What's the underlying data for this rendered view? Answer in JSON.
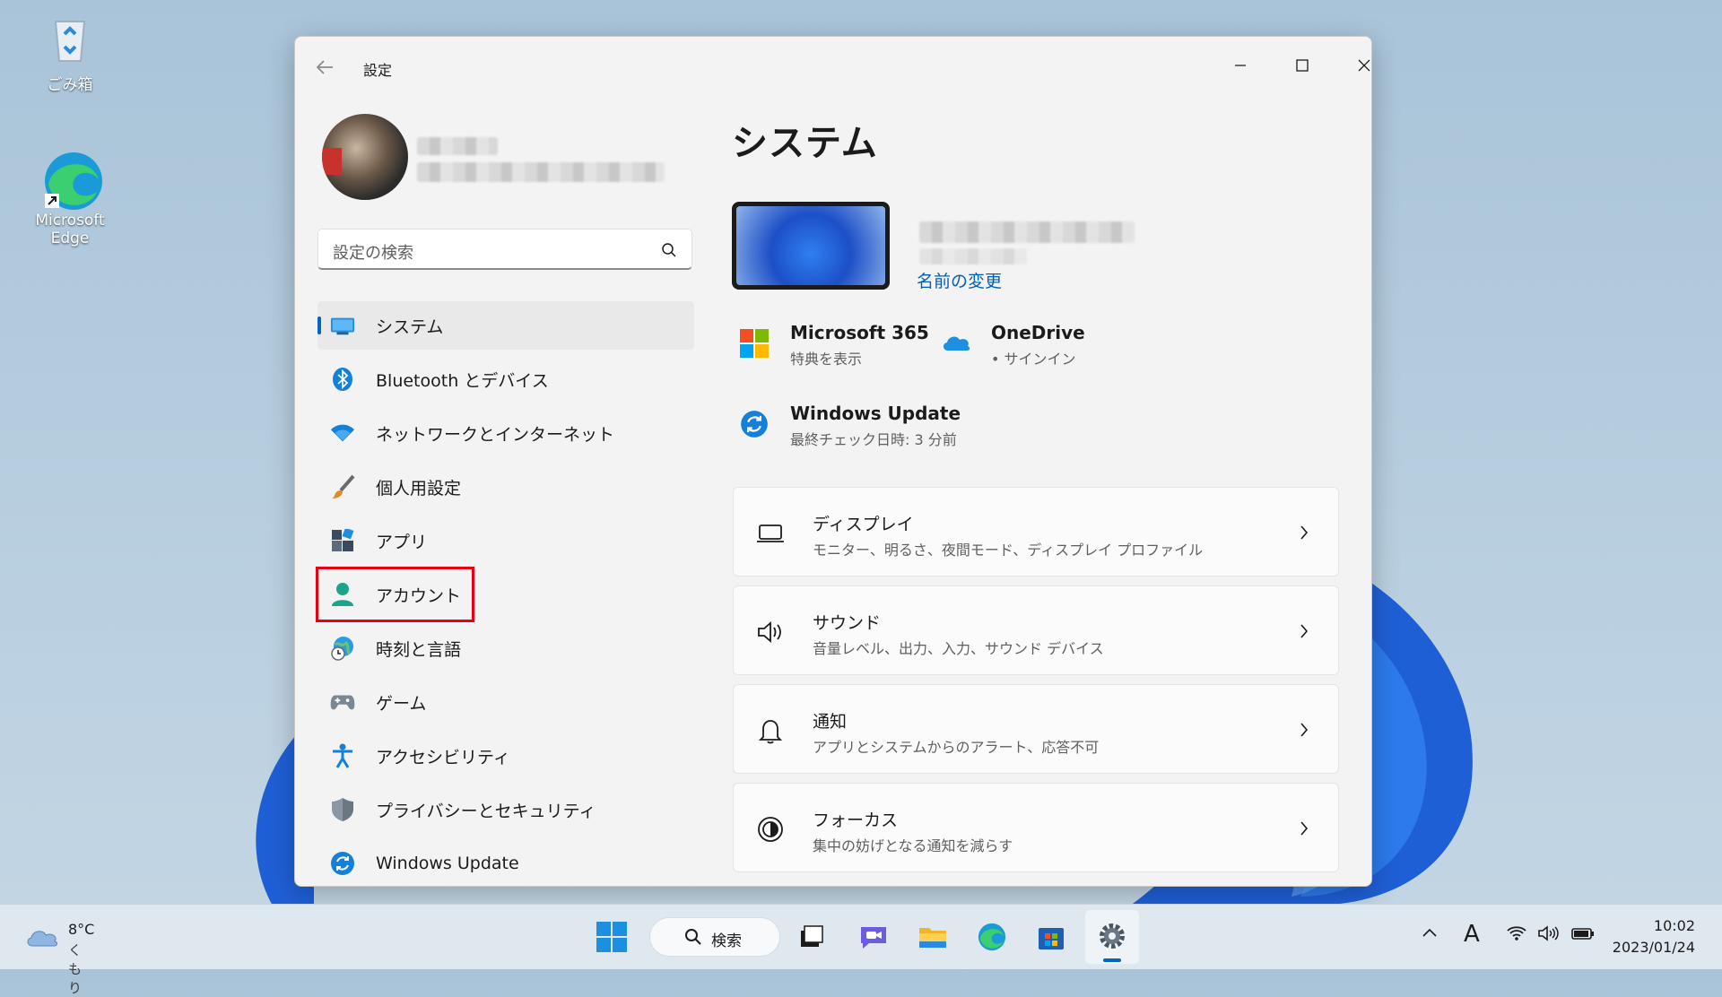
{
  "desktop": {
    "icons": [
      {
        "label": "ごみ箱",
        "icon": "recycle-bin-icon"
      },
      {
        "label": "Microsoft Edge",
        "icon": "edge-icon"
      }
    ]
  },
  "window": {
    "title": "設定",
    "back_icon": "back-arrow-icon",
    "controls": [
      "minimize-icon",
      "maximize-icon",
      "close-icon"
    ]
  },
  "sidebar": {
    "search_placeholder": "設定の検索",
    "items": [
      {
        "label": "システム",
        "icon": "system-display-icon",
        "active": true
      },
      {
        "label": "Bluetooth とデバイス",
        "icon": "bluetooth-icon"
      },
      {
        "label": "ネットワークとインターネット",
        "icon": "wifi-icon"
      },
      {
        "label": "個人用設定",
        "icon": "brush-icon"
      },
      {
        "label": "アプリ",
        "icon": "apps-icon"
      },
      {
        "label": "アカウント",
        "icon": "account-icon",
        "highlighted": true
      },
      {
        "label": "時刻と言語",
        "icon": "globe-clock-icon"
      },
      {
        "label": "ゲーム",
        "icon": "gamepad-icon"
      },
      {
        "label": "アクセシビリティ",
        "icon": "accessibility-icon"
      },
      {
        "label": "プライバシーとセキュリティ",
        "icon": "shield-icon"
      },
      {
        "label": "Windows Update",
        "icon": "update-icon"
      }
    ],
    "highlight_color": "#e60012",
    "accent": "#0067c0"
  },
  "main": {
    "title": "システム",
    "rename_link": "名前の変更",
    "tiles": [
      {
        "title": "Microsoft 365",
        "sub": "特典を表示",
        "icon": "microsoft-logo-icon"
      },
      {
        "title": "OneDrive",
        "sub": "• サインイン",
        "icon": "onedrive-cloud-icon"
      },
      {
        "title": "Windows Update",
        "sub": "最終チェック日時: 3 分前",
        "icon": "update-icon"
      }
    ],
    "cards": [
      {
        "title": "ディスプレイ",
        "sub": "モニター、明るさ、夜間モード、ディスプレイ プロファイル",
        "icon": "monitor-icon"
      },
      {
        "title": "サウンド",
        "sub": "音量レベル、出力、入力、サウンド デバイス",
        "icon": "speaker-icon"
      },
      {
        "title": "通知",
        "sub": "アプリとシステムからのアラート、応答不可",
        "icon": "bell-icon"
      },
      {
        "title": "フォーカス",
        "sub": "集中の妨げとなる通知を減らす",
        "icon": "focus-icon"
      }
    ]
  },
  "taskbar": {
    "weather_temp": "8°C",
    "weather_cond": "くもり",
    "search_label": "検索",
    "time": "10:02",
    "date": "2023/01/24",
    "ime": "A"
  }
}
